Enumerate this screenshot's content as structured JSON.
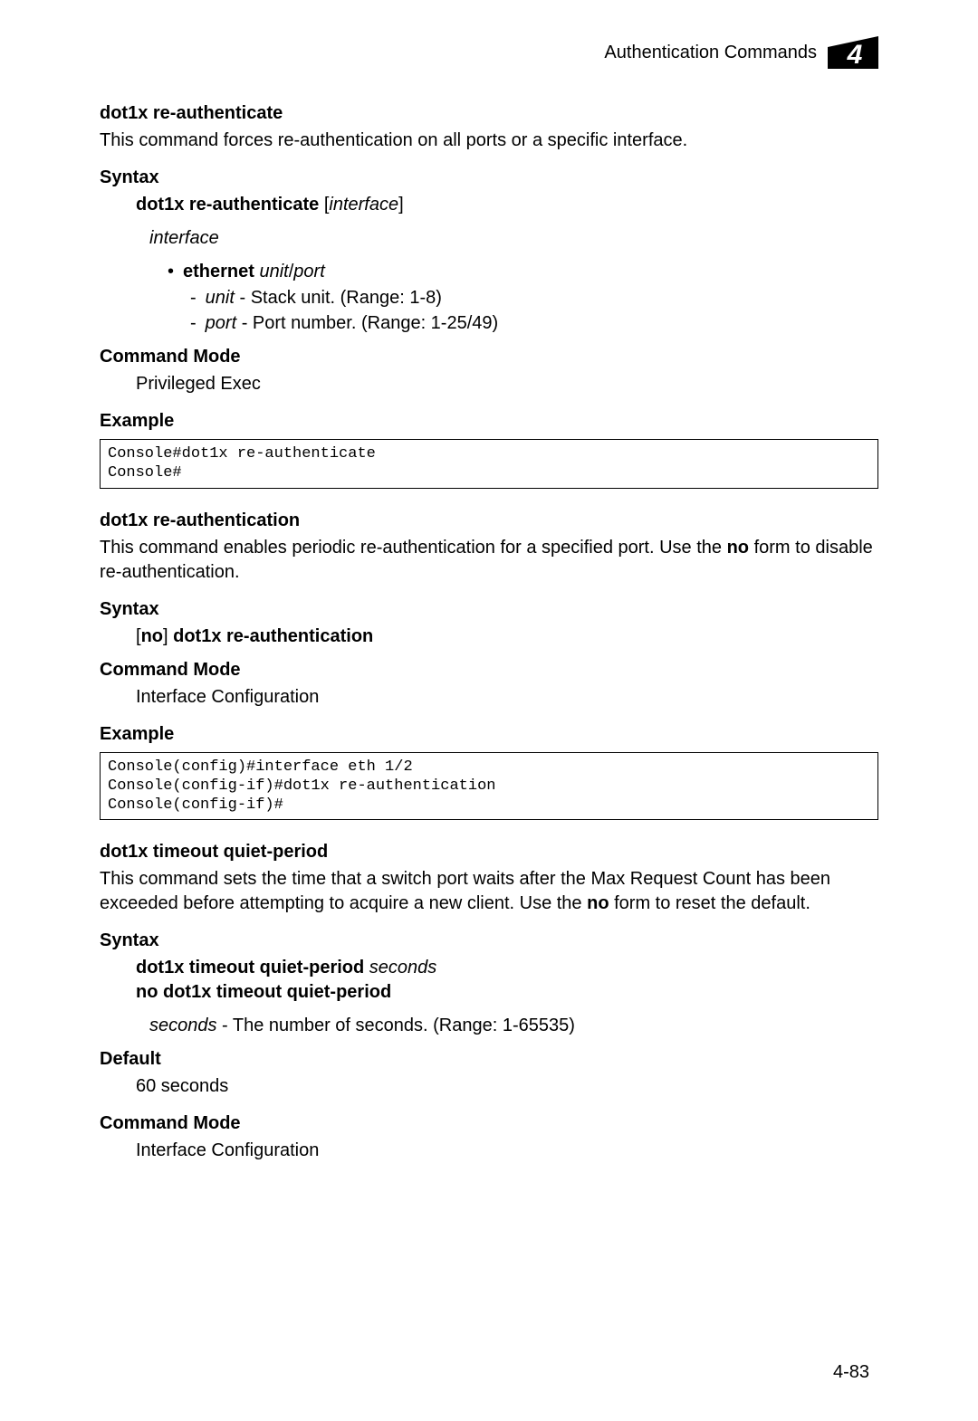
{
  "header": {
    "title": "Authentication Commands",
    "chapter_number": "4"
  },
  "cmd1": {
    "title": "dot1x re-authenticate",
    "desc": "This command forces re-authentication on all ports or a specific interface.",
    "syntax_h": "Syntax",
    "syntax_bold": "dot1x re-authenticate",
    "syntax_bracket_open": " [",
    "syntax_ital": "interface",
    "syntax_bracket_close": "]",
    "iface_label": "interface",
    "eth_bullet": "•",
    "eth_bold": "ethernet",
    "eth_ital": " unit",
    "eth_slash": "/",
    "eth_ital2": "port",
    "unit_dash": "-",
    "unit_ital": "unit",
    "unit_rest": " - Stack unit. (Range: 1-8)",
    "port_dash": "-",
    "port_ital": "port",
    "port_rest": " - Port number. (Range: 1-25/49)",
    "mode_h": "Command Mode",
    "mode_val": "Privileged Exec",
    "ex_h": "Example",
    "ex_code": "Console#dot1x re-authenticate\nConsole#"
  },
  "cmd2": {
    "title": "dot1x re-authentication",
    "desc_a": "This command enables periodic re-authentication for a specified port. Use the ",
    "desc_bold": "no",
    "desc_b": " form to disable re-authentication.",
    "syntax_h": "Syntax",
    "syntax_bracket_open": "[",
    "syntax_no": "no",
    "syntax_bracket_close": "] ",
    "syntax_rest": "dot1x re-authentication",
    "mode_h": "Command Mode",
    "mode_val": "Interface Configuration",
    "ex_h": "Example",
    "ex_code": "Console(config)#interface eth 1/2\nConsole(config-if)#dot1x re-authentication\nConsole(config-if)#"
  },
  "cmd3": {
    "title": "dot1x timeout quiet-period",
    "desc_a": "This command sets the time that a switch port waits after the Max Request Count has been exceeded before attempting to acquire a new client. Use the ",
    "desc_bold": "no",
    "desc_b": " form to reset the default.",
    "syntax_h": "Syntax",
    "syntax_l1_bold": "dot1x timeout quiet-period",
    "syntax_l1_ital": " seconds",
    "syntax_l2": "no dot1x timeout quiet-period",
    "param_ital": "seconds",
    "param_rest": " - The number of seconds. (Range: 1-65535)",
    "default_h": "Default",
    "default_val": "60 seconds",
    "mode_h": "Command Mode",
    "mode_val": "Interface Configuration"
  },
  "page_num": "4-83"
}
